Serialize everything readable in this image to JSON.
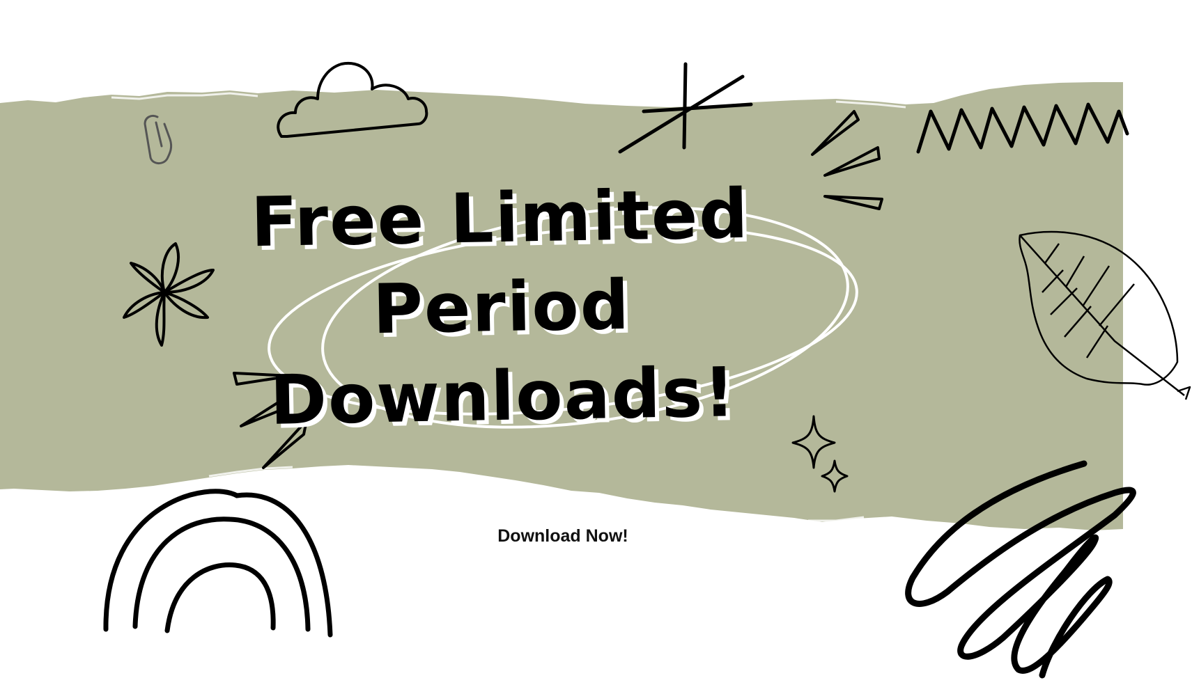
{
  "headline": {
    "line1": "Free Limited",
    "line2": "Period",
    "line3": "Downloads!"
  },
  "cta": {
    "label": "Download Now!"
  },
  "colors": {
    "background": "#ffffff",
    "torn_paper": "#b4b89a",
    "ink": "#000000",
    "highlight": "#ffffff"
  },
  "decorations": [
    "paperclip-icon",
    "cloud-icon",
    "star-burst-icon",
    "zigzag-icon",
    "flower-icon",
    "leaf-icon",
    "emphasis-lines-icon",
    "sparkle-icon",
    "rainbow-icon",
    "scribble-icon"
  ]
}
